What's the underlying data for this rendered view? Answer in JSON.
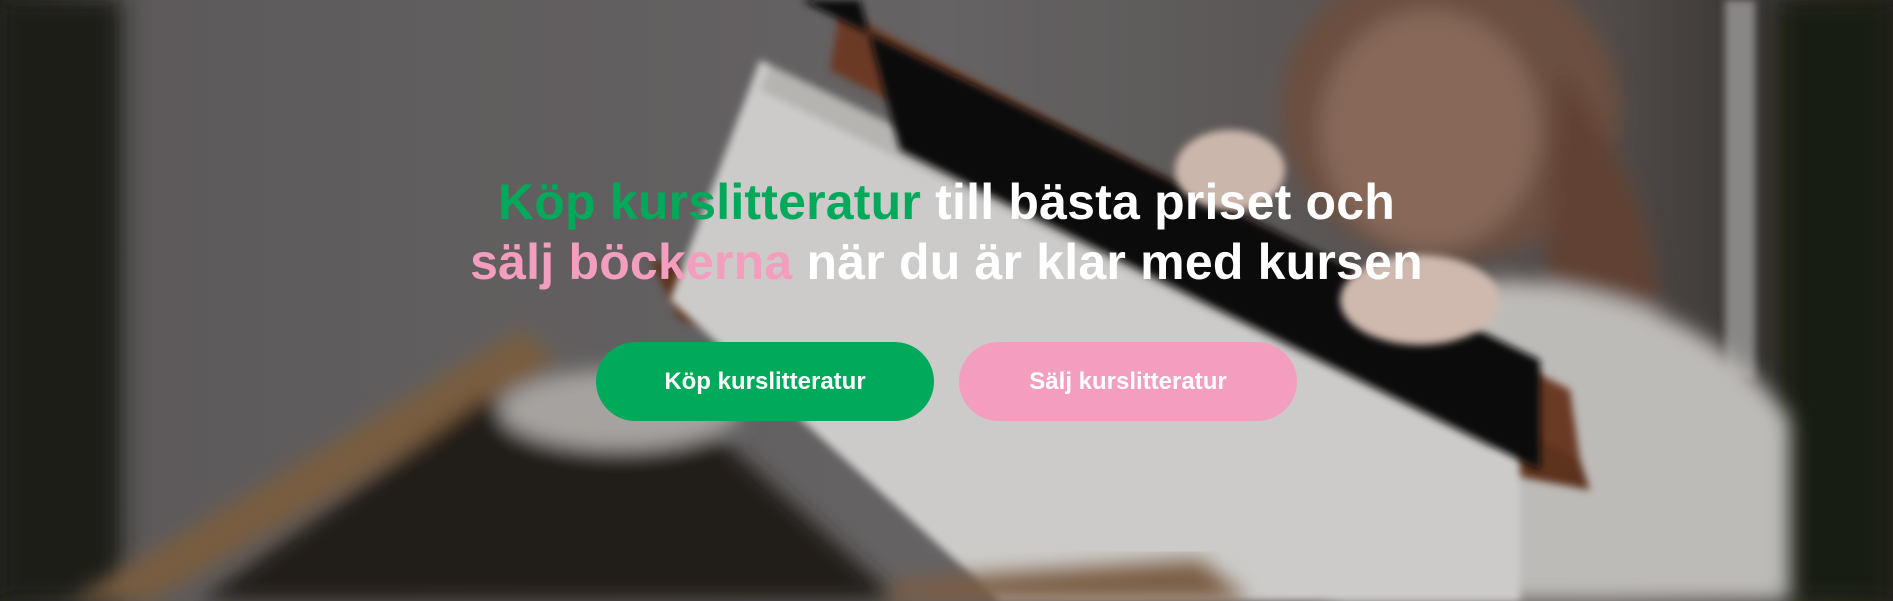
{
  "hero": {
    "headline": {
      "line1_accent": "Köp kurslitteratur",
      "line1_rest": " till bästa priset och",
      "line2_accent": "sälj böckerna",
      "line2_rest": " när du är klar med kursen"
    },
    "buttons": {
      "buy_label": "Köp kurslitteratur",
      "sell_label": "Sälj kurslitteratur"
    },
    "background_image": "blurred-photo-person-holding-book-icon"
  },
  "colors": {
    "green": "#01a95a",
    "pink": "#f49ebf",
    "white": "#ffffff"
  }
}
